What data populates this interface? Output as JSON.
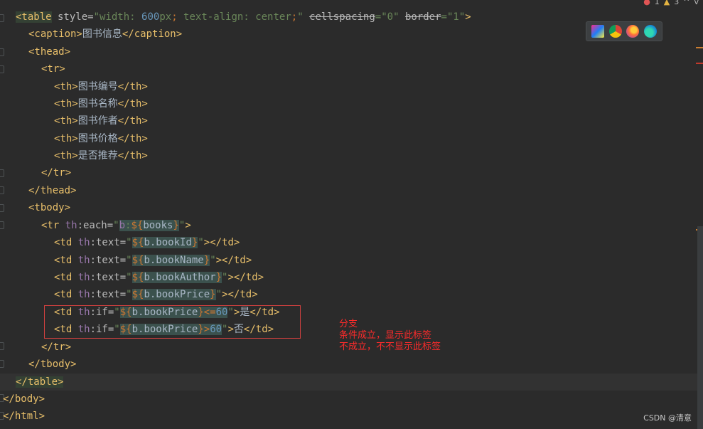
{
  "editor": {
    "status": {
      "errors": "1",
      "warnings": "3",
      "up_arrow": "^",
      "down_arrow": "v"
    },
    "browsers": [
      "jetbrains-icon",
      "chrome-icon",
      "firefox-icon",
      "edge-icon"
    ],
    "annotation": {
      "line1": "分支",
      "line2": "条件成立，显示此标签",
      "line3": "不成立，不不显示此标签"
    },
    "watermark": "CSDN @清意",
    "colors": {
      "background": "#2b2b2b",
      "tag": "#e8bf6a",
      "string": "#6a8759",
      "number": "#6897bb",
      "highlight_box": "#d0403f"
    }
  },
  "code": {
    "l1": {
      "t1": "<table",
      "a1": " style=",
      "v1": "\"width: ",
      "n1": "600",
      "v2": "px",
      "k1": ";",
      "v3": " text-align: center",
      "k2": ";",
      "v4": "\" ",
      "s1": "cellspacing",
      "v5": "=\"0\" ",
      "s2": "border",
      "v6": "=\"1\"",
      "t2": ">"
    },
    "l2": {
      "t1": "<caption>",
      "txt": "图书信息",
      "t2": "</caption>"
    },
    "l3": "<thead>",
    "l4": "<tr>",
    "l5": {
      "t1": "<th>",
      "txt": "图书编号",
      "t2": "</th>"
    },
    "l6": {
      "t1": "<th>",
      "txt": "图书名称",
      "t2": "</th>"
    },
    "l7": {
      "t1": "<th>",
      "txt": "图书作者",
      "t2": "</th>"
    },
    "l8": {
      "t1": "<th>",
      "txt": "图书价格",
      "t2": "</th>"
    },
    "l9": {
      "t1": "<th>",
      "txt": "是否推荐",
      "t2": "</th>"
    },
    "l10": "</tr>",
    "l11": "</thead>",
    "l12": "<tbody>",
    "l13": {
      "t1": "<tr ",
      "th": "th",
      "a1": ":each=",
      "v1": "\"",
      "b": "b",
      "v2": ":",
      "e1": "${",
      "books": "books",
      "e2": "}",
      "v3": "\"",
      "t2": ">"
    },
    "l14": {
      "t1": "<td ",
      "th": "th",
      "a1": ":text=",
      "v1": "\"",
      "e1": "${",
      "expr": "b.bookId",
      "e2": "}",
      "v2": "\"",
      "t2": "></td>"
    },
    "l15": {
      "t1": "<td ",
      "th": "th",
      "a1": ":text=",
      "v1": "\"",
      "e1": "${",
      "expr": "b.bookName",
      "e2": "}",
      "v2": "\"",
      "t2": "></td>"
    },
    "l16": {
      "t1": "<td ",
      "th": "th",
      "a1": ":text=",
      "v1": "\"",
      "e1": "${",
      "expr": "b.bookAuthor",
      "e2": "}",
      "v2": "\"",
      "t2": "></td>"
    },
    "l17": {
      "t1": "<td ",
      "th": "th",
      "a1": ":text=",
      "v1": "\"",
      "e1": "${",
      "expr": "b.bookPrice",
      "e2": "}",
      "v2": "\"",
      "t2": "></td>"
    },
    "l18": {
      "t1": "<td ",
      "th": "th",
      "a1": ":if=",
      "v1": "\"",
      "e1": "${",
      "expr": "b.bookPrice",
      "e2": "}",
      "op": "<=",
      "num": "60",
      "v2": "\"",
      "t2": ">",
      "txt": "是",
      "t3": "</td>"
    },
    "l19": {
      "t1": "<td ",
      "th": "th",
      "a1": ":if=",
      "v1": "\"",
      "e1": "${",
      "expr": "b.bookPrice",
      "e2": "}",
      "op": ">",
      "num": "60",
      "v2": "\"",
      "t2": ">",
      "txt": "否",
      "t3": "</td>"
    },
    "l20": "</tr>",
    "l21": "</tbody>",
    "l22": "</table>",
    "l23": "</body>",
    "l24": "</html>"
  }
}
